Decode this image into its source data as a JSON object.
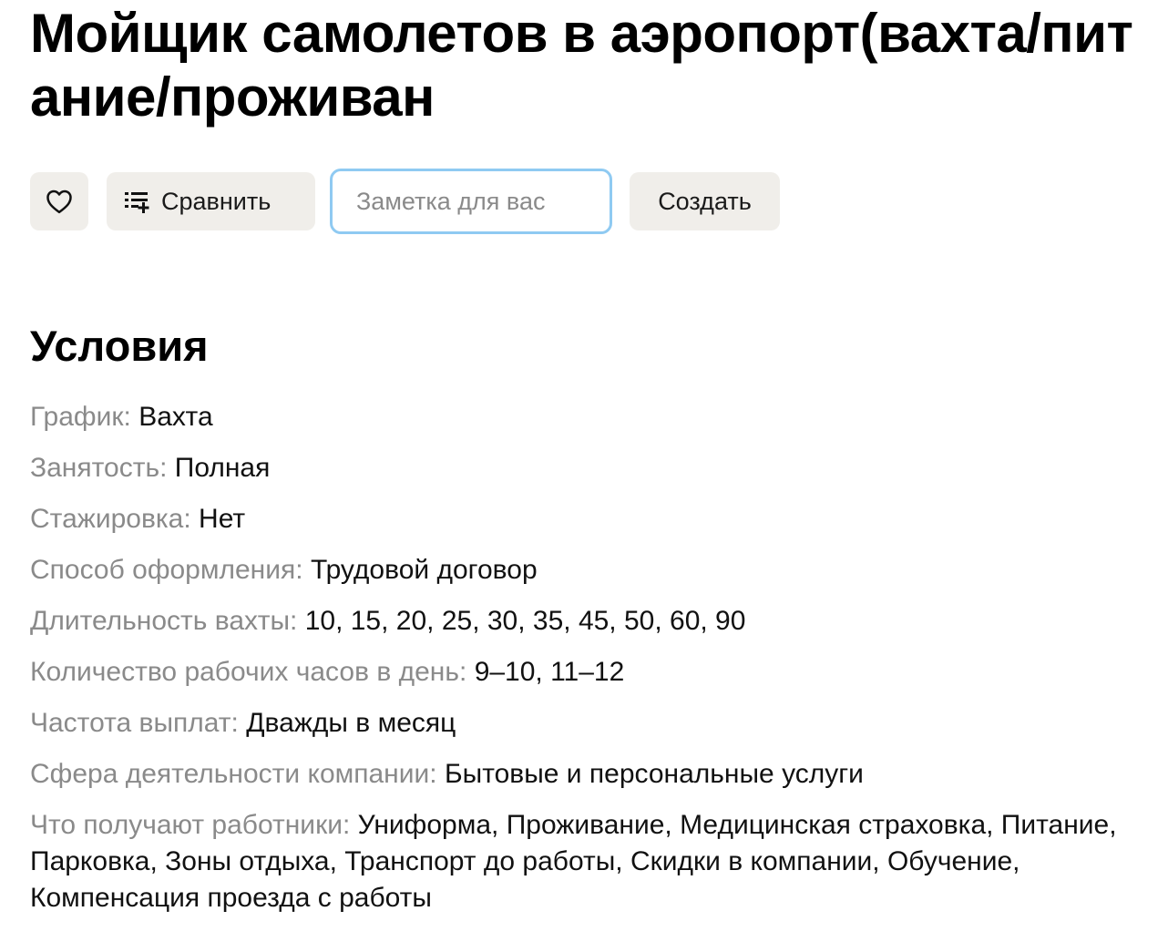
{
  "vacancy": {
    "title": "Мойщик самолетов в аэропорт(вахта/питание/проживан"
  },
  "actions": {
    "favorite_icon": "heart-icon",
    "compare_icon": "compare-list-icon",
    "compare_label": "Сравнить",
    "note_placeholder": "Заметка для вас",
    "note_value": "",
    "create_label": "Создать"
  },
  "conditions": {
    "heading": "Условия",
    "items": [
      {
        "label": "График:",
        "value": "Вахта"
      },
      {
        "label": "Занятость:",
        "value": "Полная"
      },
      {
        "label": "Стажировка:",
        "value": "Нет"
      },
      {
        "label": "Способ оформления:",
        "value": "Трудовой договор"
      },
      {
        "label": "Длительность вахты:",
        "value": "10, 15, 20, 25, 30, 35, 45, 50, 60, 90"
      },
      {
        "label": "Количество рабочих часов в день:",
        "value": "9–10, 11–12"
      },
      {
        "label": "Частота выплат:",
        "value": "Дважды в месяц"
      },
      {
        "label": "Сфера деятельности компании:",
        "value": "Бытовые и персональные услуги"
      },
      {
        "label": "Что получают работники:",
        "value": "Униформа, Проживание, Медицинская страховка, Питание, Парковка, Зоны отдыха, Транспорт до работы, Скидки в компании, Обучение, Компенсация проезда с работы"
      }
    ]
  },
  "colors": {
    "button_bg": "#f0eeea",
    "input_focus_border": "#8fcaf2",
    "label_gray": "#8a8a8a",
    "text": "#111111"
  }
}
